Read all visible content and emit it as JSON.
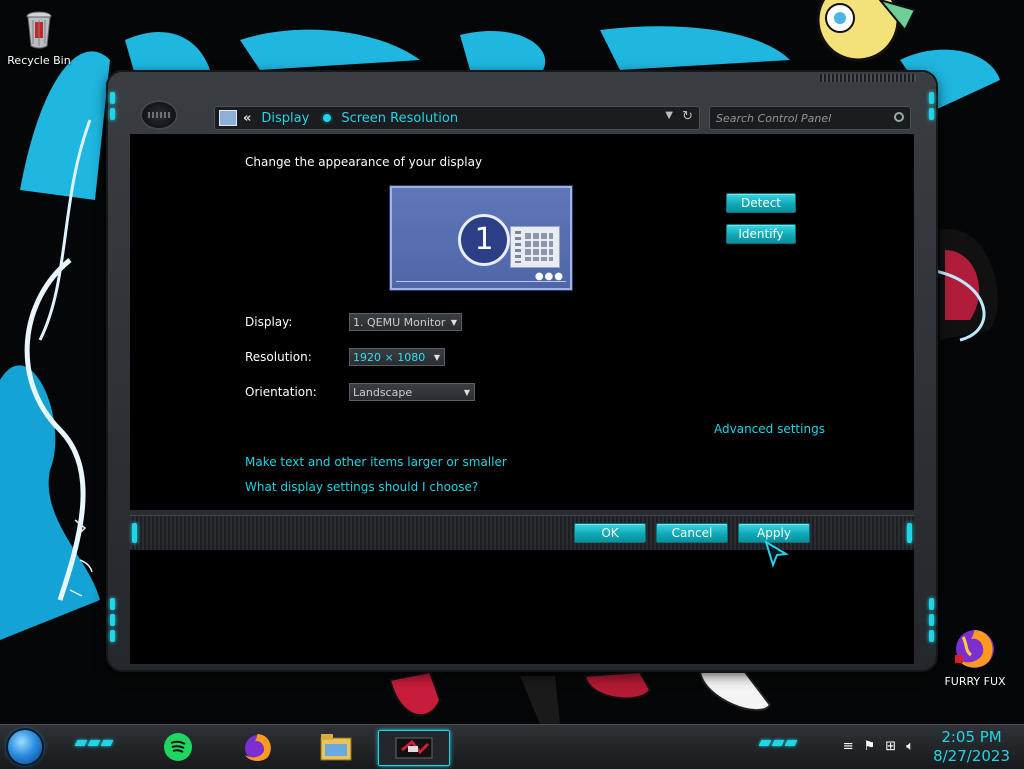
{
  "desktop": {
    "icons": [
      {
        "label": "Recycle Bin",
        "icon": "recycle-bin-icon"
      },
      {
        "label": "FURRY FUX",
        "icon": "firefox-icon"
      }
    ]
  },
  "window": {
    "breadcrumb": [
      "Display",
      "Screen Resolution"
    ],
    "search_placeholder": "Search Control Panel",
    "heading": "Change the appearance of your display",
    "monitor_number": "1",
    "detect_label": "Detect",
    "identify_label": "Identify",
    "form": {
      "display_label": "Display:",
      "display_value": "1. QEMU Monitor",
      "resolution_label": "Resolution:",
      "resolution_value": "1920 × 1080",
      "orientation_label": "Orientation:",
      "orientation_value": "Landscape"
    },
    "advanced_link": "Advanced settings",
    "links": [
      "Make text and other items larger or smaller",
      "What display settings should I choose?"
    ],
    "buttons": {
      "ok": "OK",
      "cancel": "Cancel",
      "apply": "Apply"
    }
  },
  "taskbar": {
    "apps": [
      {
        "name": "spotify-icon"
      },
      {
        "name": "firefox-icon"
      },
      {
        "name": "file-explorer-icon"
      },
      {
        "name": "control-panel-icon",
        "active": true
      }
    ],
    "tray_icons": [
      "flag-icon",
      "network-icon",
      "volume-icon"
    ],
    "time": "2:05 PM",
    "date": "8/27/2023"
  },
  "colors": {
    "accent": "#22d3e6",
    "window": "#2a2d31",
    "content": "#000000"
  }
}
